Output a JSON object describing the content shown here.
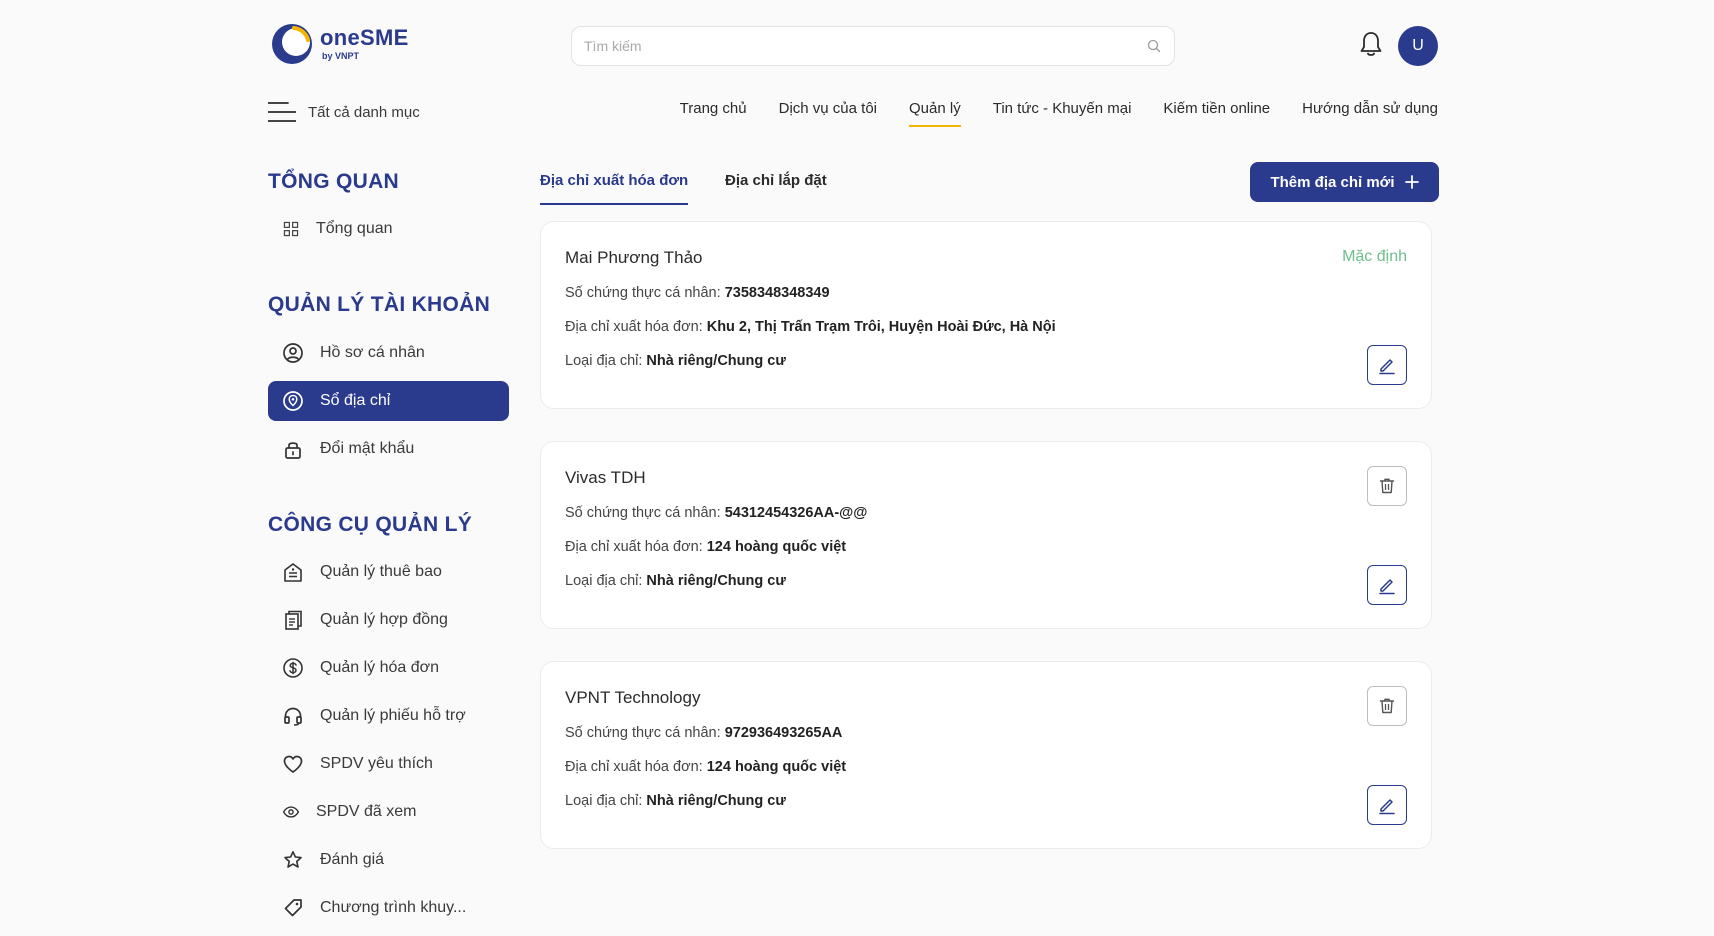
{
  "header": {
    "logo_name": "oneSME",
    "logo_sub": "by VNPT",
    "search_placeholder": "Tìm kiếm",
    "avatar_initial": "U",
    "menu_label": "Tất cả danh mục",
    "nav": [
      "Trang chủ",
      "Dịch vụ của tôi",
      "Quản lý",
      "Tin tức - Khuyến mại",
      "Kiếm tiền online",
      "Hướng dẫn sử dụng"
    ],
    "nav_active": "Quản lý"
  },
  "sidebar": {
    "overview_title": "TỔNG QUAN",
    "overview_item": "Tổng quan",
    "account_title": "QUẢN LÝ TÀI KHOẢN",
    "account_items": [
      "Hồ sơ cá nhân",
      "Sổ địa chỉ",
      "Đổi mật khẩu"
    ],
    "active_item": "Sổ địa chỉ",
    "tools_title": "CÔNG CỤ QUẢN LÝ",
    "tools_items": [
      "Quản lý thuê bao",
      "Quản lý hợp đồng",
      "Quản lý hóa đơn",
      "Quản lý phiếu hỗ trợ",
      "SPDV yêu thích",
      "SPDV đã xem",
      "Đánh giá",
      "Chương trình khuy..."
    ]
  },
  "tabs": [
    "Địa chỉ xuất hóa đơn",
    "Địa chỉ lắp đặt"
  ],
  "add_button_label": "Thêm địa chỉ mới",
  "labels": {
    "id": "Số chứng thực cá nhân:",
    "invoice_address": "Địa chỉ xuất hóa đơn:",
    "type": "Loại địa chỉ:"
  },
  "addresses": [
    {
      "name": "Mai Phương Thảo",
      "id": "7358348348349",
      "invoice_address": "Khu 2, Thị Trấn Trạm Trôi, Huyện Hoài Đức, Hà Nội",
      "type": "Nhà riêng/Chung cư",
      "default_label": "Mặc định"
    },
    {
      "name": "Vivas TDH",
      "id": "54312454326AA-@@",
      "invoice_address": "124 hoàng quốc việt",
      "type": "Nhà riêng/Chung cư"
    },
    {
      "name": "VPNT Technology",
      "id": "972936493265AA",
      "invoice_address": "124 hoàng quốc việt",
      "type": "Nhà riêng/Chung cư"
    }
  ],
  "colors": {
    "primary": "#2a3a8c",
    "accent": "#f4b400",
    "default_tag": "#6dbf8e"
  }
}
